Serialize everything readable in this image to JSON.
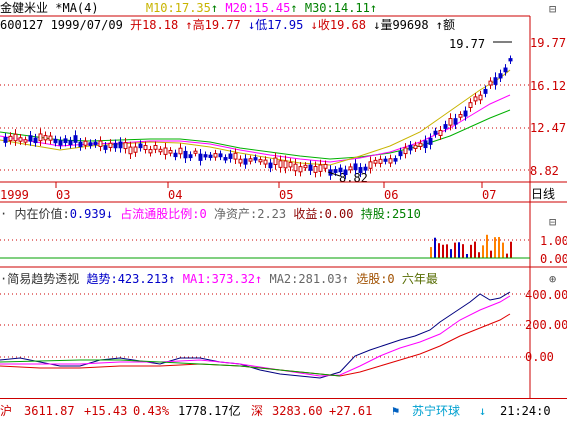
{
  "header": {
    "stock_name": "金健米业",
    "ma_label": "*MA(4)",
    "ma10": "M10:17.35",
    "ma20": "M20:15.45",
    "ma30": "M30:14.11",
    "ma10_arrow": "↑",
    "ma20_arrow": "↑",
    "ma30_arrow": "↑",
    "code_date": "600127 1999/07/09",
    "open": "开18.18",
    "high": "高19.77",
    "low": "低17.95",
    "close": "收19.68",
    "volume": "量99698",
    "amount_label": "额",
    "arrow_up": "↑",
    "arrow_down": "↓"
  },
  "right_toolbar": {
    "icon_top": "⊟",
    "icon_mid": "⊟",
    "icon_bottom": "⊕"
  },
  "price_axis": {
    "ticks": [
      "19.77",
      "16.12",
      "12.47",
      "8.82"
    ],
    "high_label": "19.77",
    "low_label": "8.82",
    "chart_type_tab": "日线"
  },
  "time_axis": {
    "labels": [
      "1999",
      "03",
      "04",
      "05",
      "06",
      "07"
    ]
  },
  "indicator1": {
    "prefix": "内在价值:",
    "value": "0.939",
    "arrow": "↓",
    "float_label": "占流通股比例:",
    "float_value": "0",
    "net_assets": "净资产:2.23",
    "income": "收益:0.00",
    "holding": "持股:2510",
    "ticks": [
      "1.00",
      "0.00"
    ]
  },
  "indicator2": {
    "name": "简易趋势透视",
    "trend": "趋势:423.213",
    "trend_arrow": "↑",
    "ma1": "MA1:373.32",
    "ma1_arrow": "↑",
    "ma2": "MA2:281.03",
    "ma2_arrow": "↑",
    "select": "选股:0",
    "period": "六年最",
    "ticks": [
      "400.00",
      "200.00",
      "0.00"
    ]
  },
  "status": {
    "sh_label": "沪",
    "sh_index": "3611.87",
    "sh_change": "+15.43",
    "sh_pct": "0.43%",
    "sh_amount": "1778.17亿",
    "sz_label": "深",
    "sz_index": "3283.60",
    "sz_change": "+27.61",
    "broker": "苏宁环球",
    "broker_arrow": "↓",
    "time": "21:24:0"
  },
  "colors": {
    "up": "#cc0000",
    "down": "#008000",
    "ma10": "#c8b400",
    "ma20": "#ff00ff",
    "ma30": "#008000"
  }
}
